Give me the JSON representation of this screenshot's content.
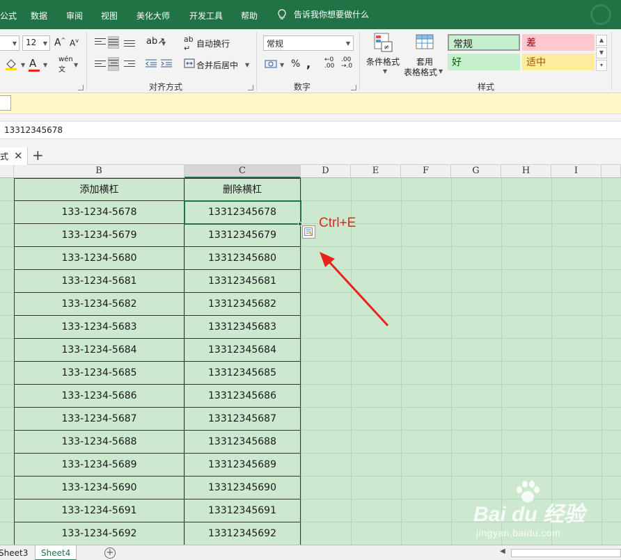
{
  "ribbon_tabs": [
    "公式",
    "数据",
    "审阅",
    "视图",
    "美化大师",
    "开发工具",
    "帮助"
  ],
  "tell_me": "告诉我你想要做什么",
  "font": {
    "size": "12"
  },
  "alignment": {
    "wrap_text": "自动换行",
    "merge_center": "合并后居中",
    "group_label": "对齐方式"
  },
  "number": {
    "format": "常规",
    "percent": "%",
    "comma": ",",
    "group_label": "数字"
  },
  "styles": {
    "conditional_format": "条件格式",
    "format_as_table_line1": "套用",
    "format_as_table_line2": "表格格式",
    "group_label": "样式",
    "normal": "常规",
    "bad": "差",
    "good": "好",
    "neutral": "适中",
    "normal_color": "#c6efce",
    "bad_color": "#ffc7ce",
    "good_color": "#c6efce",
    "neutral_color": "#ffeb9c"
  },
  "formula_bar": {
    "value": "13312345678"
  },
  "workbook_tab": {
    "label": "式"
  },
  "columns": [
    "B",
    "C",
    "D",
    "E",
    "F",
    "G",
    "H",
    "I"
  ],
  "table": {
    "headers": [
      "添加横杠",
      "删除横杠"
    ],
    "rows": [
      [
        "133-1234-5678",
        "13312345678"
      ],
      [
        "133-1234-5679",
        "13312345679"
      ],
      [
        "133-1234-5680",
        "13312345680"
      ],
      [
        "133-1234-5681",
        "13312345681"
      ],
      [
        "133-1234-5682",
        "13312345682"
      ],
      [
        "133-1234-5683",
        "13312345683"
      ],
      [
        "133-1234-5684",
        "13312345684"
      ],
      [
        "133-1234-5685",
        "13312345685"
      ],
      [
        "133-1234-5686",
        "13312345686"
      ],
      [
        "133-1234-5687",
        "13312345687"
      ],
      [
        "133-1234-5688",
        "13312345688"
      ],
      [
        "133-1234-5689",
        "13312345689"
      ],
      [
        "133-1234-5690",
        "13312345690"
      ],
      [
        "133-1234-5691",
        "13312345691"
      ],
      [
        "133-1234-5692",
        "13312345692"
      ]
    ]
  },
  "annotation": {
    "shortcut": "Ctrl+E",
    "color": "#e8231c"
  },
  "sheets": [
    "Sheet3",
    "Sheet4"
  ],
  "active_sheet": "Sheet4",
  "watermark": {
    "brand": "Bai du 经验",
    "url": "jingyan.baidu.com"
  },
  "colors": {
    "accent": "#217346",
    "grid_bg": "#cce8cf"
  }
}
